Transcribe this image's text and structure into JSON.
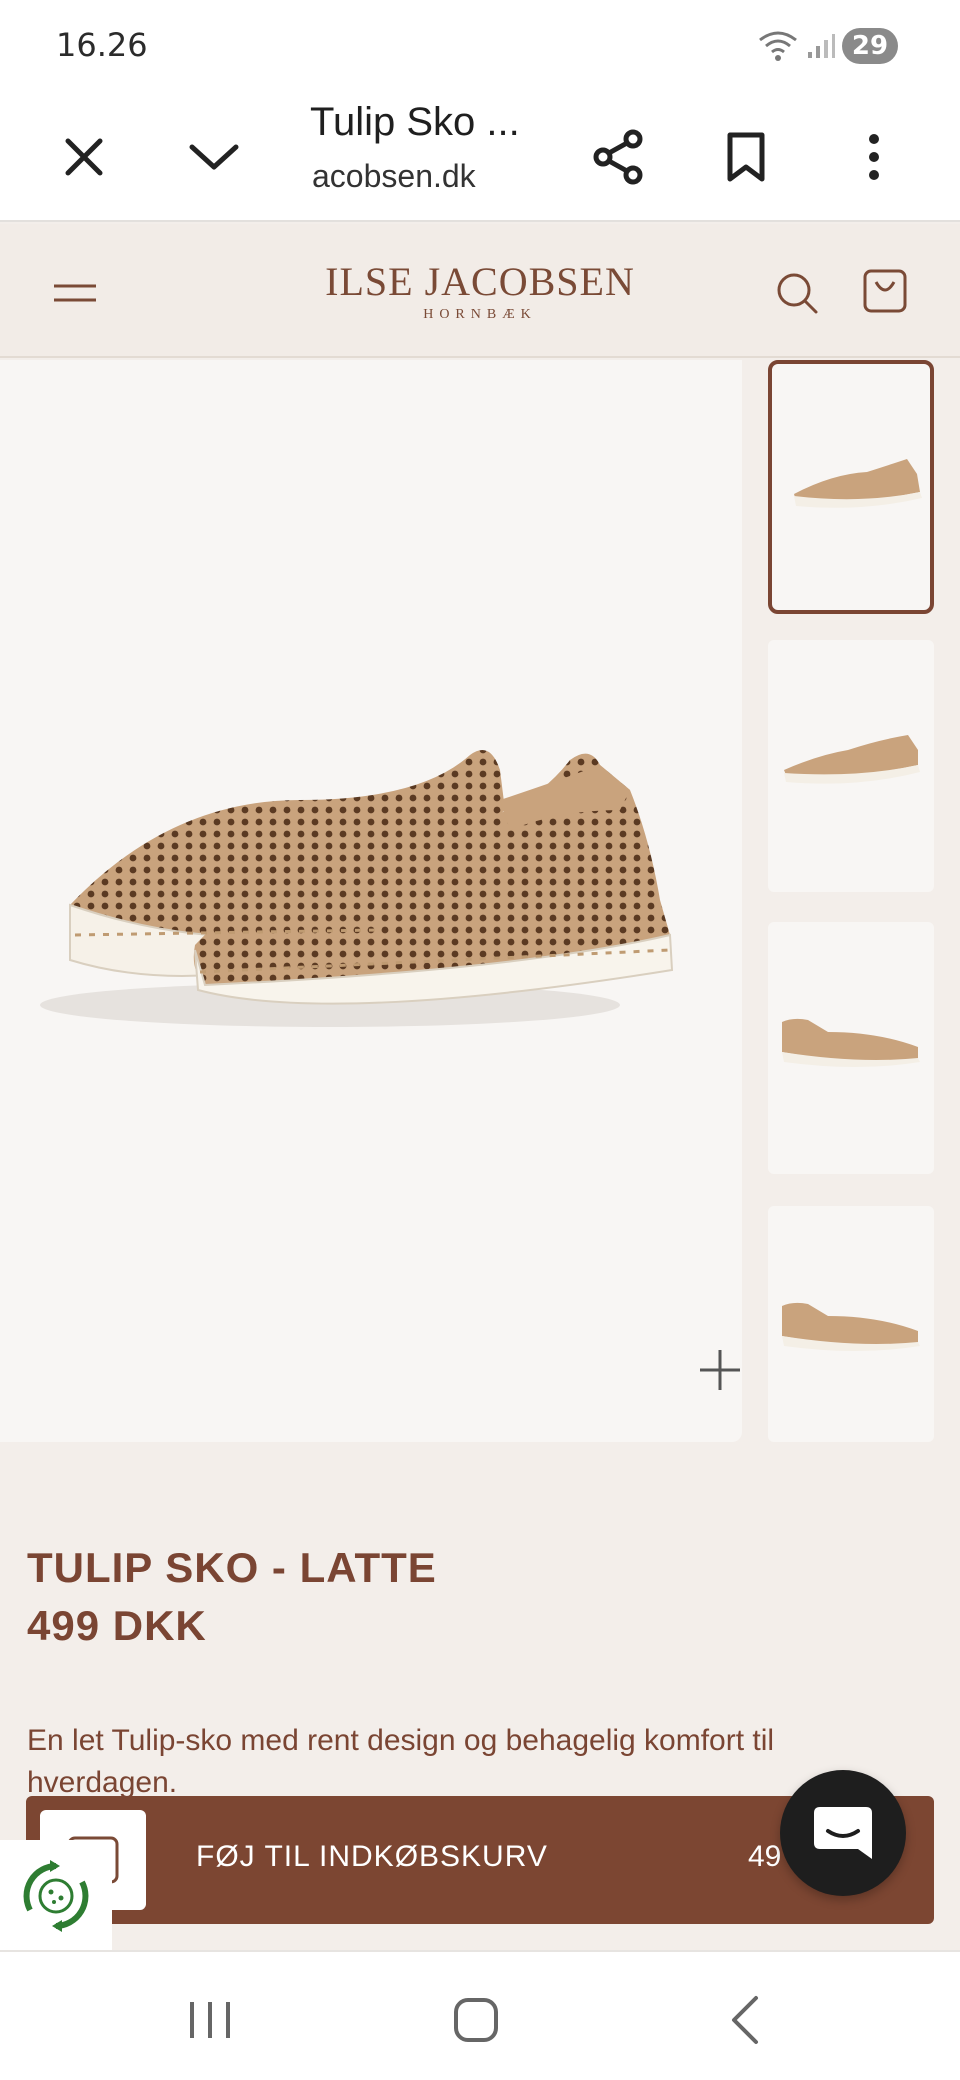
{
  "status_bar": {
    "time": "16.26",
    "battery": "29"
  },
  "browser": {
    "tab_title": "Tulip Sko ...",
    "url": "acobsen.dk",
    "icons": [
      "close-icon",
      "chevron-down-icon",
      "share-icon",
      "bookmark-icon",
      "more-vert-icon"
    ]
  },
  "site": {
    "logo_main": "ILSE JACOBSEN",
    "logo_sub": "HORNBÆK",
    "icons": [
      "menu-icon",
      "search-icon",
      "bag-icon"
    ]
  },
  "gallery": {
    "thumbnail_count": 4,
    "active_thumbnail": 1
  },
  "product": {
    "title": "TULIP SKO - LATTE",
    "price": "499 DKK",
    "description": "En let Tulip-sko med rent design og behagelig komfort til hverdagen."
  },
  "cart_bar": {
    "button_label": "FØJ TIL INDKØBSKURV",
    "price_partial": "49"
  },
  "colors": {
    "brand_brown": "#7c4632",
    "header_bg": "#f2ece7",
    "page_bg": "#f3eeea"
  }
}
